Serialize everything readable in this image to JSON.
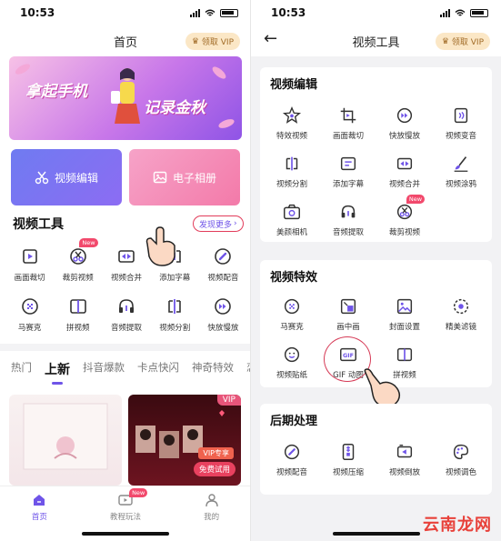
{
  "status": {
    "time": "10:53"
  },
  "left": {
    "nav_title": "首页",
    "vip_label": "领取 VIP",
    "banner": {
      "line1": "拿起手机",
      "line2": "记录金秋"
    },
    "big_buttons": {
      "edit": "视频编辑",
      "album": "电子相册"
    },
    "tools_title": "视频工具",
    "more": "发现更多",
    "tools": [
      {
        "label": "画面裁切",
        "icon": "crop-icon"
      },
      {
        "label": "裁剪视频",
        "icon": "scissors-icon",
        "badge": "New"
      },
      {
        "label": "视频合并",
        "icon": "merge-icon"
      },
      {
        "label": "添加字幕",
        "icon": "subtitle-icon"
      },
      {
        "label": "视频配音",
        "icon": "dub-icon"
      },
      {
        "label": "马赛克",
        "icon": "mosaic-icon"
      },
      {
        "label": "拼视频",
        "icon": "split-screen-icon"
      },
      {
        "label": "音频提取",
        "icon": "headphone-icon"
      },
      {
        "label": "视频分割",
        "icon": "split-icon"
      },
      {
        "label": "快放慢放",
        "icon": "speed-icon"
      }
    ],
    "tabs": [
      "热门",
      "上新",
      "抖音爆款",
      "卡点快闪",
      "神奇特效",
      "恋爱"
    ],
    "active_tab": 1,
    "card_vip": "VIP",
    "card_vip_exclusive": "VIP专享",
    "card_trial": "免费试用",
    "tabbar": [
      {
        "label": "首页",
        "icon": "home-icon"
      },
      {
        "label": "教程玩法",
        "icon": "video-tutorial-icon",
        "badge": "New"
      },
      {
        "label": "我的",
        "icon": "profile-icon"
      }
    ]
  },
  "right": {
    "nav_title": "视频工具",
    "vip_label": "领取 VIP",
    "sections": [
      {
        "title": "视频编辑",
        "items": [
          {
            "label": "特效视频",
            "icon": "star-icon"
          },
          {
            "label": "画面裁切",
            "icon": "crop-icon"
          },
          {
            "label": "快放慢放",
            "icon": "speed-icon"
          },
          {
            "label": "视频变音",
            "icon": "voice-change-icon"
          },
          {
            "label": "视频分割",
            "icon": "split-icon"
          },
          {
            "label": "添加字幕",
            "icon": "subtitle-icon"
          },
          {
            "label": "视频合并",
            "icon": "merge-icon"
          },
          {
            "label": "视频涂鸦",
            "icon": "brush-icon"
          },
          {
            "label": "美颜相机",
            "icon": "camera-icon"
          },
          {
            "label": "音频提取",
            "icon": "headphone-icon"
          },
          {
            "label": "裁剪视频",
            "icon": "scissors-icon",
            "badge": "New"
          }
        ]
      },
      {
        "title": "视频特效",
        "items": [
          {
            "label": "马赛克",
            "icon": "mosaic-icon"
          },
          {
            "label": "画中画",
            "icon": "pip-icon"
          },
          {
            "label": "封面设置",
            "icon": "image-icon"
          },
          {
            "label": "精美滤镜",
            "icon": "filter-icon"
          },
          {
            "label": "视频贴纸",
            "icon": "sticker-icon"
          },
          {
            "label": "GIF 动图",
            "icon": "gif-icon"
          },
          {
            "label": "拼视频",
            "icon": "split-screen-icon"
          }
        ]
      },
      {
        "title": "后期处理",
        "items": [
          {
            "label": "视频配音",
            "icon": "dub-icon"
          },
          {
            "label": "视频压缩",
            "icon": "compress-icon"
          },
          {
            "label": "视频倒放",
            "icon": "reverse-icon"
          },
          {
            "label": "视频调色",
            "icon": "palette-icon"
          }
        ]
      }
    ]
  },
  "watermark": "云南龙网",
  "colors": {
    "accent": "#6f54e8",
    "highlight": "#d63b57",
    "vip_gold": "#a06a26"
  }
}
